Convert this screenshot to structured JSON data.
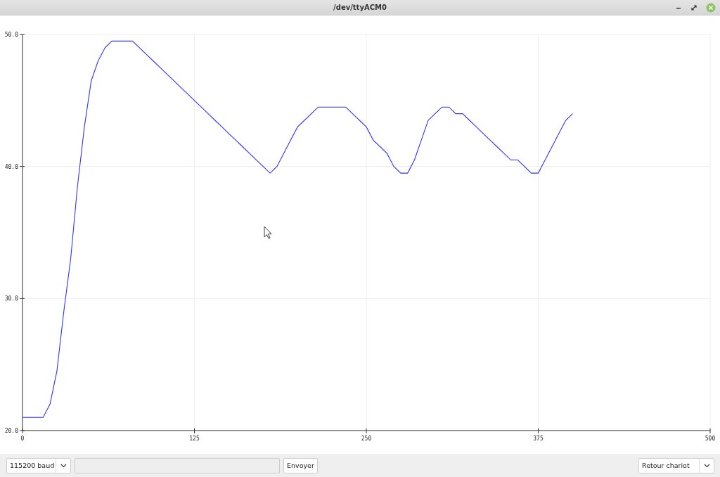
{
  "window": {
    "title": "/dev/ttyACM0"
  },
  "chart_data": {
    "type": "line",
    "xlim": [
      0,
      500
    ],
    "ylim": [
      20,
      50
    ],
    "xticks": [
      0,
      125,
      250,
      375,
      500
    ],
    "yticks": [
      {
        "value": 20,
        "label": "20.0"
      },
      {
        "value": 30,
        "label": "30.0"
      },
      {
        "value": 40,
        "label": "40.0"
      },
      {
        "value": 50,
        "label": "50.0"
      }
    ],
    "x": [
      0,
      5,
      10,
      15,
      20,
      25,
      30,
      35,
      40,
      45,
      50,
      55,
      60,
      65,
      70,
      75,
      80,
      85,
      90,
      95,
      100,
      105,
      110,
      115,
      120,
      125,
      130,
      135,
      140,
      145,
      150,
      155,
      160,
      165,
      170,
      175,
      180,
      185,
      190,
      195,
      200,
      205,
      210,
      215,
      220,
      225,
      230,
      235,
      240,
      245,
      250,
      255,
      260,
      265,
      270,
      275,
      280,
      285,
      290,
      295,
      300,
      305,
      310,
      315,
      320,
      325,
      330,
      335,
      340,
      345,
      350,
      355,
      360,
      365,
      370,
      375,
      380,
      385,
      390,
      395,
      400
    ],
    "grid": true,
    "series": [
      {
        "color": "#3333ff",
        "values": [
          21,
          21,
          21,
          21,
          22,
          24.5,
          29,
          33,
          38.5,
          43,
          46.5,
          48,
          49,
          49.5,
          49.5,
          49.5,
          49.5,
          49,
          48.5,
          48,
          47.5,
          47,
          46.5,
          46,
          45.5,
          45,
          44.5,
          44,
          43.5,
          43,
          42.5,
          42,
          41.5,
          41,
          40.5,
          40,
          39.5,
          40,
          41,
          42,
          43,
          43.5,
          44,
          44.5,
          44.5,
          44.5,
          44.5,
          44.5,
          44,
          43.5,
          43,
          42,
          41.5,
          41,
          40,
          39.5,
          39.5,
          40.5,
          42,
          43.5,
          44,
          44.5,
          44.5,
          44,
          44,
          43.5,
          43,
          42.5,
          42,
          41.5,
          41,
          40.5,
          40.5,
          40,
          39.5,
          39.5,
          40.5,
          41.5,
          42.5,
          43.5,
          44
        ]
      }
    ]
  },
  "controls": {
    "baud": "115200 baud",
    "send_button": "Envoyer",
    "line_ending": "Retour chariot"
  }
}
